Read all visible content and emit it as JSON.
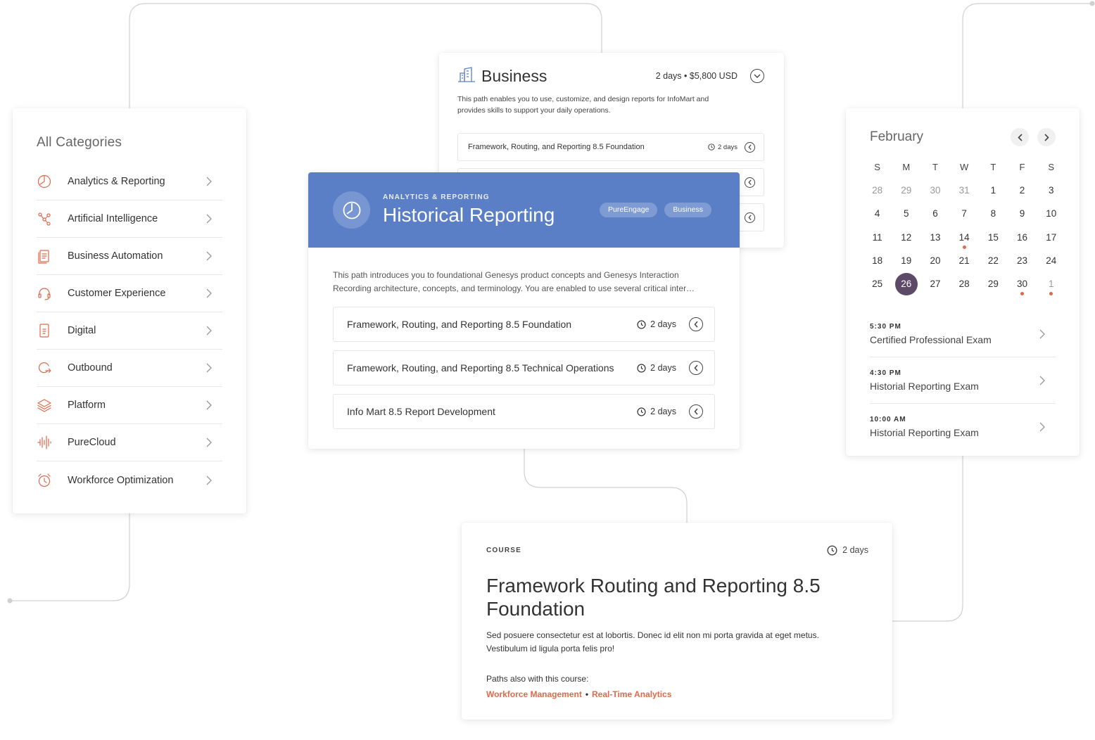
{
  "categories": {
    "title": "All Categories",
    "items": [
      {
        "label": "Analytics & Reporting",
        "icon": "pie-chart-icon"
      },
      {
        "label": "Artificial Intelligence",
        "icon": "ai-network-icon"
      },
      {
        "label": "Business Automation",
        "icon": "documents-icon"
      },
      {
        "label": "Customer Experience",
        "icon": "headset-icon"
      },
      {
        "label": "Digital",
        "icon": "tablet-icon"
      },
      {
        "label": "Outbound",
        "icon": "outbound-arrow-icon"
      },
      {
        "label": "Platform",
        "icon": "layers-icon"
      },
      {
        "label": "PureCloud",
        "icon": "waveform-icon"
      },
      {
        "label": "Workforce Optimization",
        "icon": "alarm-clock-icon"
      }
    ]
  },
  "business": {
    "title": "Business",
    "duration": "2 days",
    "separator": "•",
    "price": "$5,800 USD",
    "description": "This path enables you to use, customize, and design reports for InfoMart and provides skills to support your daily operations.",
    "rows": [
      {
        "label": "Framework, Routing, and Reporting 8.5 Foundation",
        "duration": "2 days"
      },
      {
        "label": "",
        "duration": ""
      },
      {
        "label": "",
        "duration": ""
      }
    ]
  },
  "historical": {
    "eyebrow": "ANALYTICS & REPORTING",
    "title": "Historical Reporting",
    "tags": [
      "PureEngage",
      "Business"
    ],
    "description": "This path introduces you to foundational Genesys product concepts and Genesys Interaction Recording architecture, concepts, and terminology. You are enabled to use several critical inter…",
    "courses": [
      {
        "label": "Framework, Routing, and Reporting 8.5 Foundation",
        "duration": "2 days"
      },
      {
        "label": "Framework, Routing, and Reporting 8.5 Technical Operations",
        "duration": "2 days"
      },
      {
        "label": "Info Mart 8.5 Report Development",
        "duration": "2 days"
      }
    ]
  },
  "calendar": {
    "month": "February",
    "weekdays": [
      "S",
      "M",
      "T",
      "W",
      "T",
      "F",
      "S"
    ],
    "weeks": [
      [
        {
          "d": "28",
          "m": true
        },
        {
          "d": "29",
          "m": true
        },
        {
          "d": "30",
          "m": true
        },
        {
          "d": "31",
          "m": true
        },
        {
          "d": "1"
        },
        {
          "d": "2"
        },
        {
          "d": "3"
        }
      ],
      [
        {
          "d": "4"
        },
        {
          "d": "5"
        },
        {
          "d": "6"
        },
        {
          "d": "7"
        },
        {
          "d": "8"
        },
        {
          "d": "9"
        },
        {
          "d": "10"
        }
      ],
      [
        {
          "d": "11"
        },
        {
          "d": "12"
        },
        {
          "d": "13"
        },
        {
          "d": "14",
          "dot": true
        },
        {
          "d": "15"
        },
        {
          "d": "16"
        },
        {
          "d": "17"
        }
      ],
      [
        {
          "d": "18"
        },
        {
          "d": "19"
        },
        {
          "d": "20"
        },
        {
          "d": "21"
        },
        {
          "d": "22"
        },
        {
          "d": "23"
        },
        {
          "d": "24"
        }
      ],
      [
        {
          "d": "25"
        },
        {
          "d": "26",
          "sel": true
        },
        {
          "d": "27"
        },
        {
          "d": "28"
        },
        {
          "d": "29"
        },
        {
          "d": "30",
          "dot": true
        },
        {
          "d": "1",
          "m": true,
          "dot": true
        }
      ]
    ],
    "events": [
      {
        "time": "5:30 PM",
        "name": "Certified Professional Exam"
      },
      {
        "time": "4:30 PM",
        "name": "Historial Reporting Exam"
      },
      {
        "time": "10:00 AM",
        "name": "Historial Reporting Exam"
      }
    ]
  },
  "course": {
    "eyebrow": "COURSE",
    "duration": "2 days",
    "title": "Framework Routing and Reporting 8.5 Foundation",
    "description": "Sed posuere consectetur est at lobortis. Donec id elit non mi porta gravida at eget metus. Vestibulum id ligula porta felis pro!",
    "paths_label": "Paths also with this course:",
    "paths": [
      "Workforce Management",
      "Real-Time Analytics"
    ],
    "paths_separator": "•"
  },
  "colors": {
    "accent": "#e0694a",
    "header_blue": "#5b7fc7",
    "selected_day": "#5d4a66"
  }
}
